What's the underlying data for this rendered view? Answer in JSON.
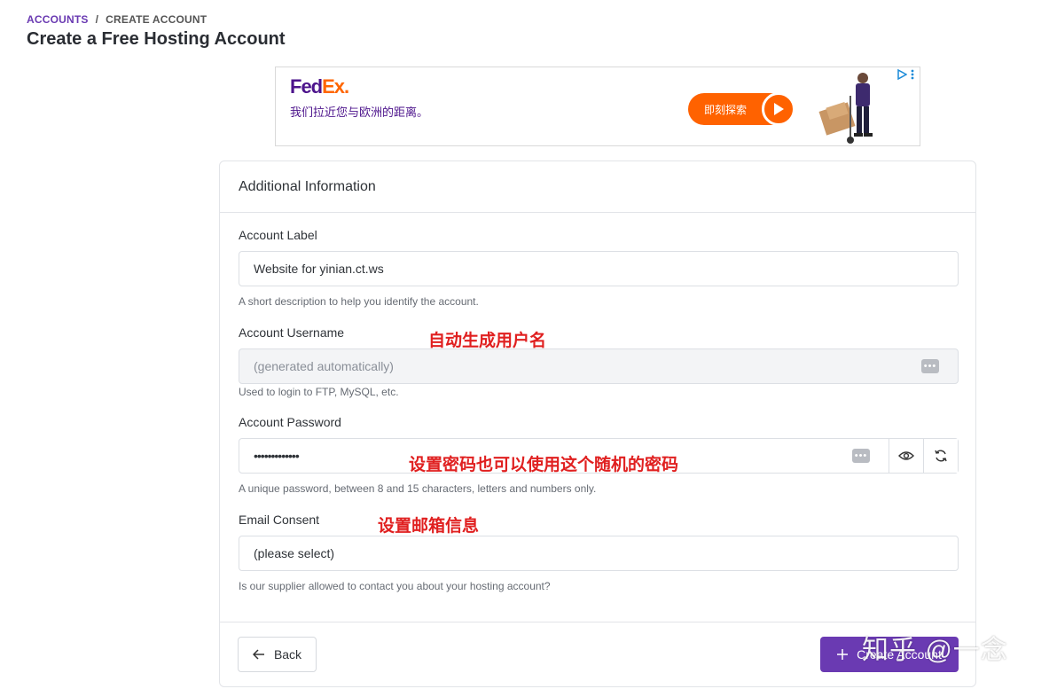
{
  "breadcrumb": {
    "root": "ACCOUNTS",
    "separator": "/",
    "current": "CREATE ACCOUNT"
  },
  "page_title": "Create a Free Hosting Account",
  "ad": {
    "logo_part1": "Fed",
    "logo_part2": "Ex",
    "logo_dot": ".",
    "text": "我们拉近您与欧洲的距离。",
    "cta_label": "即刻探索",
    "cta_icon": "play-icon",
    "choices_icon": "ad-choices-icon",
    "colors": {
      "purple": "#4d148c",
      "orange": "#ff6200"
    }
  },
  "card": {
    "header": "Additional Information",
    "fields": {
      "label": {
        "label": "Account Label",
        "value": "Website for yinian.ct.ws",
        "help": "A short description to help you identify the account."
      },
      "username": {
        "label": "Account Username",
        "placeholder": "(generated automatically)",
        "help": "Used to login to FTP, MySQL, etc.",
        "icon": "more-dots-icon"
      },
      "password": {
        "label": "Account Password",
        "value": "•••••••••••••",
        "help": "A unique password, between 8 and 15 characters, letters and numbers only.",
        "icons": [
          "more-dots-icon",
          "eye-icon",
          "refresh-icon"
        ]
      },
      "email_consent": {
        "label": "Email Consent",
        "selected": "(please select)",
        "help": "Is our supplier allowed to contact you about your hosting account?"
      }
    },
    "footer": {
      "back_label": "Back",
      "create_label": "Create Account"
    }
  },
  "annotations": {
    "username": "自动生成用户名",
    "password": "设置密码也可以使用这个随机的密码",
    "email": "设置邮箱信息"
  },
  "watermark": "知乎 @一念",
  "colors": {
    "accent": "#6a3ab2",
    "annotation": "#e02020"
  }
}
